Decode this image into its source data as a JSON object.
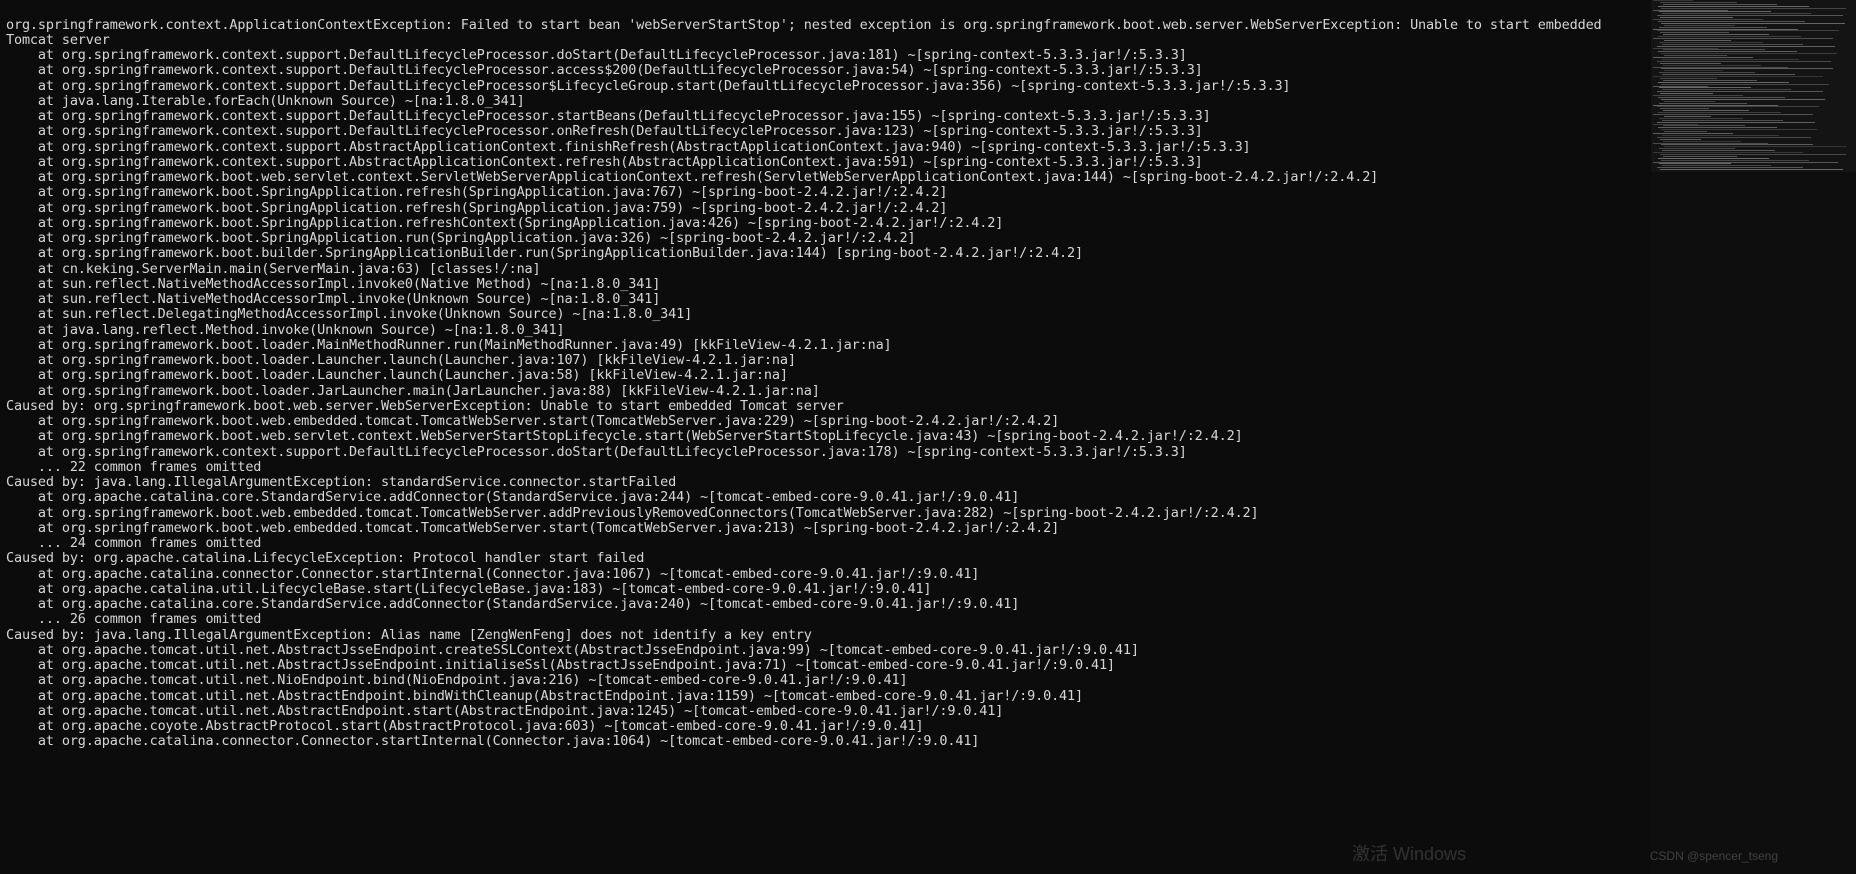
{
  "stack": {
    "lines": [
      "org.springframework.context.ApplicationContextException: Failed to start bean 'webServerStartStop'; nested exception is org.springframework.boot.web.server.WebServerException: Unable to start embedded",
      "Tomcat server",
      "    at org.springframework.context.support.DefaultLifecycleProcessor.doStart(DefaultLifecycleProcessor.java:181) ~[spring-context-5.3.3.jar!/:5.3.3]",
      "    at org.springframework.context.support.DefaultLifecycleProcessor.access$200(DefaultLifecycleProcessor.java:54) ~[spring-context-5.3.3.jar!/:5.3.3]",
      "    at org.springframework.context.support.DefaultLifecycleProcessor$LifecycleGroup.start(DefaultLifecycleProcessor.java:356) ~[spring-context-5.3.3.jar!/:5.3.3]",
      "    at java.lang.Iterable.forEach(Unknown Source) ~[na:1.8.0_341]",
      "    at org.springframework.context.support.DefaultLifecycleProcessor.startBeans(DefaultLifecycleProcessor.java:155) ~[spring-context-5.3.3.jar!/:5.3.3]",
      "    at org.springframework.context.support.DefaultLifecycleProcessor.onRefresh(DefaultLifecycleProcessor.java:123) ~[spring-context-5.3.3.jar!/:5.3.3]",
      "    at org.springframework.context.support.AbstractApplicationContext.finishRefresh(AbstractApplicationContext.java:940) ~[spring-context-5.3.3.jar!/:5.3.3]",
      "    at org.springframework.context.support.AbstractApplicationContext.refresh(AbstractApplicationContext.java:591) ~[spring-context-5.3.3.jar!/:5.3.3]",
      "    at org.springframework.boot.web.servlet.context.ServletWebServerApplicationContext.refresh(ServletWebServerApplicationContext.java:144) ~[spring-boot-2.4.2.jar!/:2.4.2]",
      "    at org.springframework.boot.SpringApplication.refresh(SpringApplication.java:767) ~[spring-boot-2.4.2.jar!/:2.4.2]",
      "    at org.springframework.boot.SpringApplication.refresh(SpringApplication.java:759) ~[spring-boot-2.4.2.jar!/:2.4.2]",
      "    at org.springframework.boot.SpringApplication.refreshContext(SpringApplication.java:426) ~[spring-boot-2.4.2.jar!/:2.4.2]",
      "    at org.springframework.boot.SpringApplication.run(SpringApplication.java:326) ~[spring-boot-2.4.2.jar!/:2.4.2]",
      "    at org.springframework.boot.builder.SpringApplicationBuilder.run(SpringApplicationBuilder.java:144) [spring-boot-2.4.2.jar!/:2.4.2]",
      "    at cn.keking.ServerMain.main(ServerMain.java:63) [classes!/:na]",
      "    at sun.reflect.NativeMethodAccessorImpl.invoke0(Native Method) ~[na:1.8.0_341]",
      "    at sun.reflect.NativeMethodAccessorImpl.invoke(Unknown Source) ~[na:1.8.0_341]",
      "    at sun.reflect.DelegatingMethodAccessorImpl.invoke(Unknown Source) ~[na:1.8.0_341]",
      "    at java.lang.reflect.Method.invoke(Unknown Source) ~[na:1.8.0_341]",
      "    at org.springframework.boot.loader.MainMethodRunner.run(MainMethodRunner.java:49) [kkFileView-4.2.1.jar:na]",
      "    at org.springframework.boot.loader.Launcher.launch(Launcher.java:107) [kkFileView-4.2.1.jar:na]",
      "    at org.springframework.boot.loader.Launcher.launch(Launcher.java:58) [kkFileView-4.2.1.jar:na]",
      "    at org.springframework.boot.loader.JarLauncher.main(JarLauncher.java:88) [kkFileView-4.2.1.jar:na]",
      "Caused by: org.springframework.boot.web.server.WebServerException: Unable to start embedded Tomcat server",
      "    at org.springframework.boot.web.embedded.tomcat.TomcatWebServer.start(TomcatWebServer.java:229) ~[spring-boot-2.4.2.jar!/:2.4.2]",
      "    at org.springframework.boot.web.servlet.context.WebServerStartStopLifecycle.start(WebServerStartStopLifecycle.java:43) ~[spring-boot-2.4.2.jar!/:2.4.2]",
      "    at org.springframework.context.support.DefaultLifecycleProcessor.doStart(DefaultLifecycleProcessor.java:178) ~[spring-context-5.3.3.jar!/:5.3.3]",
      "    ... 22 common frames omitted",
      "Caused by: java.lang.IllegalArgumentException: standardService.connector.startFailed",
      "    at org.apache.catalina.core.StandardService.addConnector(StandardService.java:244) ~[tomcat-embed-core-9.0.41.jar!/:9.0.41]",
      "    at org.springframework.boot.web.embedded.tomcat.TomcatWebServer.addPreviouslyRemovedConnectors(TomcatWebServer.java:282) ~[spring-boot-2.4.2.jar!/:2.4.2]",
      "    at org.springframework.boot.web.embedded.tomcat.TomcatWebServer.start(TomcatWebServer.java:213) ~[spring-boot-2.4.2.jar!/:2.4.2]",
      "    ... 24 common frames omitted",
      "Caused by: org.apache.catalina.LifecycleException: Protocol handler start failed",
      "    at org.apache.catalina.connector.Connector.startInternal(Connector.java:1067) ~[tomcat-embed-core-9.0.41.jar!/:9.0.41]",
      "    at org.apache.catalina.util.LifecycleBase.start(LifecycleBase.java:183) ~[tomcat-embed-core-9.0.41.jar!/:9.0.41]",
      "    at org.apache.catalina.core.StandardService.addConnector(StandardService.java:240) ~[tomcat-embed-core-9.0.41.jar!/:9.0.41]",
      "    ... 26 common frames omitted",
      "Caused by: java.lang.IllegalArgumentException: Alias name [ZengWenFeng] does not identify a key entry",
      "    at org.apache.tomcat.util.net.AbstractJsseEndpoint.createSSLContext(AbstractJsseEndpoint.java:99) ~[tomcat-embed-core-9.0.41.jar!/:9.0.41]",
      "    at org.apache.tomcat.util.net.AbstractJsseEndpoint.initialiseSsl(AbstractJsseEndpoint.java:71) ~[tomcat-embed-core-9.0.41.jar!/:9.0.41]",
      "    at org.apache.tomcat.util.net.NioEndpoint.bind(NioEndpoint.java:216) ~[tomcat-embed-core-9.0.41.jar!/:9.0.41]",
      "    at org.apache.tomcat.util.net.AbstractEndpoint.bindWithCleanup(AbstractEndpoint.java:1159) ~[tomcat-embed-core-9.0.41.jar!/:9.0.41]",
      "    at org.apache.tomcat.util.net.AbstractEndpoint.start(AbstractEndpoint.java:1245) ~[tomcat-embed-core-9.0.41.jar!/:9.0.41]",
      "    at org.apache.coyote.AbstractProtocol.start(AbstractProtocol.java:603) ~[tomcat-embed-core-9.0.41.jar!/:9.0.41]",
      "    at org.apache.catalina.connector.Connector.startInternal(Connector.java:1064) ~[tomcat-embed-core-9.0.41.jar!/:9.0.41]"
    ]
  },
  "watermark": {
    "activate_title": "激活 Windows",
    "csdn": "CSDN @spencer_tseng"
  }
}
